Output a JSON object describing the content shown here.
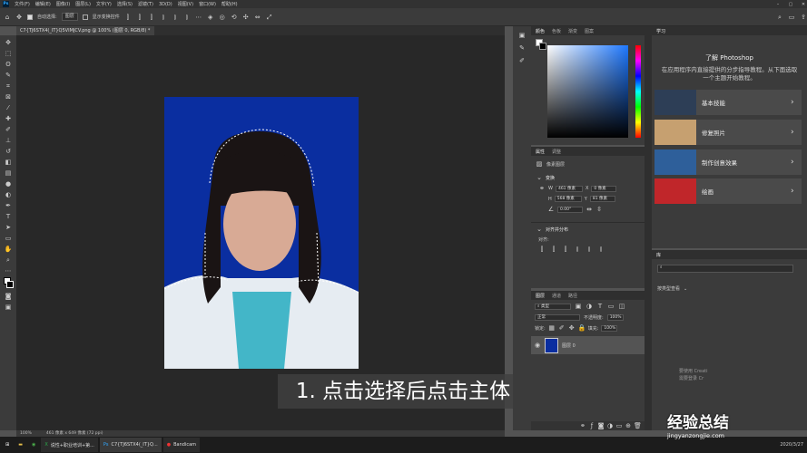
{
  "menubar": {
    "logo": "Ps",
    "items": [
      "文件(F)",
      "编辑(E)",
      "图像(I)",
      "图层(L)",
      "文字(Y)",
      "选择(S)",
      "滤镜(T)",
      "3D(D)",
      "视图(V)",
      "窗口(W)",
      "帮助(H)"
    ]
  },
  "options": {
    "auto_select": "自动选择:",
    "auto_select_value": "图层",
    "show_transform": "显示变换控件"
  },
  "document": {
    "tab_title": "C7{TJ6STX4(_IT}Q5VIMJCV.png @ 100% (图层 0, RGB/8) *"
  },
  "status": {
    "zoom": "100%",
    "doc_size": "461 像素 x 649 像素 (72 ppi)"
  },
  "subtitle": "1. 点击选择后点击主体",
  "color_panel": {
    "tabs": [
      "颜色",
      "色板",
      "渐变",
      "图案"
    ]
  },
  "properties": {
    "tabs": [
      "属性",
      "调整"
    ],
    "layer_type": "像素图层",
    "transform_title": "变换",
    "w_label": "W",
    "w_value": "461 像素",
    "x_label": "X",
    "x_value": "0 像素",
    "h_label": "H",
    "h_value": "568 像素",
    "y_label": "Y",
    "y_value": "81 像素",
    "angle": "0.00°",
    "align_title": "对齐并分布",
    "align_label": "对齐:"
  },
  "layers": {
    "tabs": [
      "图层",
      "通道",
      "路径"
    ],
    "kind": "类型",
    "blend_mode": "正常",
    "opacity_label": "不透明度:",
    "opacity_value": "100%",
    "lock_label": "锁定:",
    "fill_label": "填充:",
    "fill_value": "100%",
    "layer_name": "图层 0"
  },
  "learn": {
    "tab": "学习",
    "title": "了解 Photoshop",
    "desc": "在应用程序内直接提供的分步指导教程。从下面选取一个主题开始教程。",
    "cards": [
      {
        "label": "基本技能",
        "color": "#2d3e56"
      },
      {
        "label": "修复照片",
        "color": "#c6a070"
      },
      {
        "label": "制作创意效果",
        "color": "#2e5f9a"
      },
      {
        "label": "绘画",
        "color": "#c0262a"
      }
    ]
  },
  "library": {
    "tab": "库",
    "dropdown": "按类型查看",
    "footer_a": "要使用 Creati",
    "footer_b": "需要登录 Cr"
  },
  "taskbar": {
    "items": [
      {
        "label": "",
        "icon": "start-icon"
      },
      {
        "label": "",
        "icon": "folder-icon"
      },
      {
        "label": "",
        "icon": "browser-icon"
      },
      {
        "label": "说性+职业培训+第...",
        "icon": "excel-icon"
      },
      {
        "label": "C7{TJ6STX4(_IT}Q...",
        "icon": "ps-icon"
      },
      {
        "label": "Bandicam",
        "icon": "record-icon"
      }
    ],
    "date": "2020/3/27"
  },
  "watermark": {
    "brand": "经验总结",
    "url": "jingyanzongjie.com"
  },
  "colors": {
    "photo_bg": "#0a2ea0",
    "accent": "#31a8ff",
    "hue_bar": "rainbow"
  }
}
